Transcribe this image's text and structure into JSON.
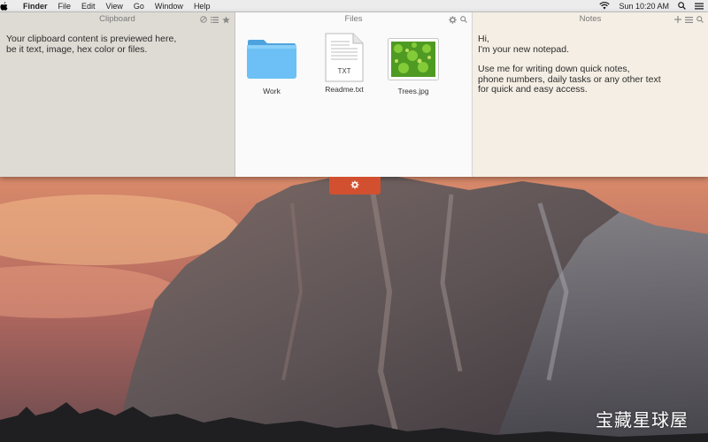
{
  "menubar": {
    "apple_icon": "apple-icon",
    "items": [
      "Finder",
      "File",
      "Edit",
      "View",
      "Go",
      "Window",
      "Help"
    ],
    "clock": "Sun 10:20 AM"
  },
  "clipboard": {
    "title": "Clipboard",
    "text": "Your clipboard content is previewed here, be it text, image, hex color or files."
  },
  "files": {
    "title": "Files",
    "items": [
      {
        "name": "Work",
        "kind": "folder-icon"
      },
      {
        "name": "Readme.txt",
        "kind": "text-file-icon",
        "badge": "TXT"
      },
      {
        "name": "Trees.jpg",
        "kind": "image-file-icon"
      }
    ]
  },
  "notes": {
    "title": "Notes",
    "lines_1": [
      "Hi,",
      "I'm your new notepad."
    ],
    "lines_2": [
      "Use me for writing down quick notes,",
      "phone numbers, daily tasks or any other text",
      "for quick and easy access."
    ]
  },
  "watermark": "宝藏星球屋",
  "colors": {
    "handle": "#d2502f",
    "folder": "#5ab4ee"
  }
}
